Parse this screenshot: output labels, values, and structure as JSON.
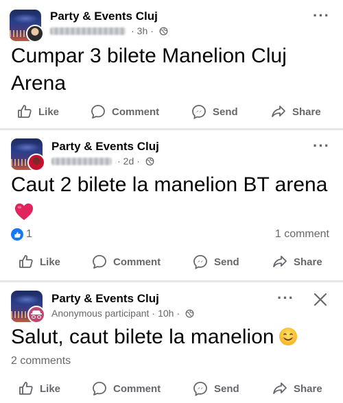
{
  "posts": [
    {
      "group_name": "Party & Events Cluj",
      "time": "3h",
      "text": "Cumpar 3 bilete Manelion Cluj Arena",
      "actions": {
        "like": "Like",
        "comment": "Comment",
        "send": "Send",
        "share": "Share"
      }
    },
    {
      "group_name": "Party & Events Cluj",
      "time": "2d",
      "text": "Caut 2 bilete la manelion BT arena",
      "reaction_count": "1",
      "comments": "1 comment",
      "actions": {
        "like": "Like",
        "comment": "Comment",
        "send": "Send",
        "share": "Share"
      }
    },
    {
      "group_name": "Party & Events Cluj",
      "author": "Anonymous participant",
      "time": "10h",
      "text": "Salut, caut bilete la manelion",
      "comments": "2 comments",
      "actions": {
        "like": "Like",
        "comment": "Comment",
        "send": "Send",
        "share": "Share"
      }
    }
  ],
  "icons": {
    "more": "more-options-icon",
    "close": "close-icon",
    "privacy": "globe-icon",
    "like": "thumbs-up-icon",
    "comment": "comment-bubble-icon",
    "send": "messenger-icon",
    "share": "share-arrow-icon",
    "heart": "red-heart-emoji",
    "smile": "smiling-face-emoji"
  },
  "colors": {
    "text": "#050505",
    "secondary": "#65676b",
    "like_blue": "#1877f2",
    "divider": "#e4e6eb",
    "heart_red": "#e0245e"
  }
}
